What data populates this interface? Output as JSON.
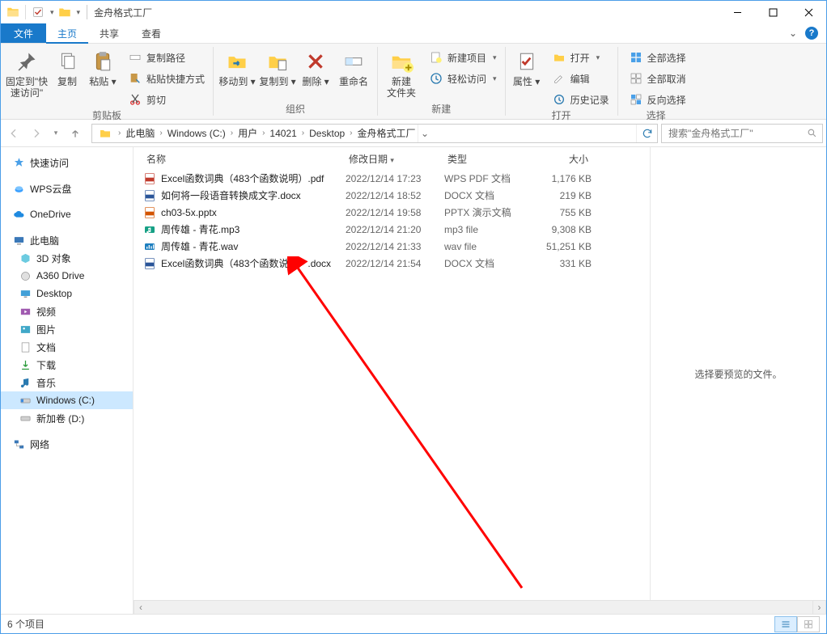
{
  "window": {
    "title": "金舟格式工厂"
  },
  "tabs": {
    "file": "文件",
    "home": "主页",
    "share": "共享",
    "view": "查看"
  },
  "ribbon": {
    "pin": {
      "label": "固定到\"快\n速访问\""
    },
    "copy": "复制",
    "paste": "粘贴",
    "copypath": "复制路径",
    "pasteshortcut": "粘贴快捷方式",
    "cut": "剪切",
    "group_clipboard": "剪贴板",
    "moveto": "移动到",
    "copyto": "复制到",
    "delete": "删除",
    "rename": "重命名",
    "group_organize": "组织",
    "newfolder": "新建\n文件夹",
    "new_item": "新建项目",
    "easy_access": "轻松访问",
    "group_new": "新建",
    "properties": "属性",
    "open": "打开",
    "edit": "编辑",
    "history": "历史记录",
    "group_open": "打开",
    "selectall": "全部选择",
    "selectnone": "全部取消",
    "invert": "反向选择",
    "group_select": "选择"
  },
  "breadcrumb": {
    "pc": "此电脑",
    "c": "Windows (C:)",
    "users": "用户",
    "uid": "14021",
    "desktop": "Desktop",
    "folder": "金舟格式工厂"
  },
  "search": {
    "placeholder": "搜索\"金舟格式工厂\""
  },
  "navpane": {
    "quick": "快速访问",
    "wps": "WPS云盘",
    "onedrive": "OneDrive",
    "pc": "此电脑",
    "3d": "3D 对象",
    "a360": "A360 Drive",
    "desktop": "Desktop",
    "videos": "视频",
    "pictures": "图片",
    "documents": "文档",
    "downloads": "下载",
    "music": "音乐",
    "cdrive": "Windows (C:)",
    "ddrive": "新加卷 (D:)",
    "network": "网络"
  },
  "columns": {
    "name": "名称",
    "date": "修改日期",
    "type": "类型",
    "size": "大小"
  },
  "files": [
    {
      "icon": "pdf",
      "name": "Excel函数词典（483个函数说明）.pdf",
      "date": "2022/12/14 17:23",
      "type": "WPS PDF 文档",
      "size": "1,176 KB"
    },
    {
      "icon": "docx",
      "name": "如何将一段语音转换成文字.docx",
      "date": "2022/12/14 18:52",
      "type": "DOCX 文档",
      "size": "219 KB"
    },
    {
      "icon": "pptx",
      "name": "ch03-5x.pptx",
      "date": "2022/12/14 19:58",
      "type": "PPTX 演示文稿",
      "size": "755 KB"
    },
    {
      "icon": "mp3",
      "name": "周传雄 - 青花.mp3",
      "date": "2022/12/14 21:20",
      "type": "mp3 file",
      "size": "9,308 KB"
    },
    {
      "icon": "wav",
      "name": "周传雄 - 青花.wav",
      "date": "2022/12/14 21:33",
      "type": "wav file",
      "size": "51,251 KB"
    },
    {
      "icon": "docx",
      "name": "Excel函数词典（483个函数说明）.docx",
      "date": "2022/12/14 21:54",
      "type": "DOCX 文档",
      "size": "331 KB"
    }
  ],
  "preview_placeholder": "选择要预览的文件。",
  "status": {
    "count": "6 个项目"
  }
}
